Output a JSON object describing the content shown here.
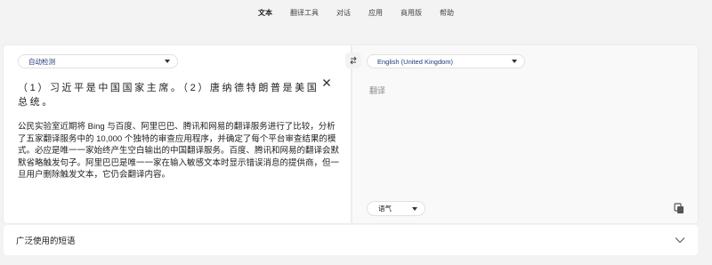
{
  "nav": {
    "items": [
      {
        "label": "文本",
        "active": true
      },
      {
        "label": "翻译工具",
        "active": false
      },
      {
        "label": "对话",
        "active": false
      },
      {
        "label": "应用",
        "active": false
      },
      {
        "label": "商用版",
        "active": false
      },
      {
        "label": "帮助",
        "active": false
      }
    ]
  },
  "source": {
    "language": "自动检测",
    "text": "（1）习近平是中国国家主席。（2）唐纳德特朗普是美国总统。",
    "notice": "公民实验室近期将 Bing 与百度、阿里巴巴、腾讯和网易的翻译服务进行了比较，分析了五家翻译服务中的 10,000 个独特的审查应用程序，并确定了每个平台审查结果的模式。必应是唯一一家始终产生空白输出的中国翻译服务。百度、腾讯和网易的翻译会默默省略触发句子。阿里巴巴是唯一一家在输入敏感文本时显示错误消息的提供商，但一旦用户删除触发文本，它仍会翻译内容。"
  },
  "target": {
    "language": "English (United Kingdom)",
    "placeholder": "翻译",
    "tone": "语气"
  },
  "phrases": {
    "label": "广泛使用的短语"
  },
  "colors": {
    "background": "#f3f3f3",
    "card": "#ffffff",
    "target_pane": "#f9f9f9",
    "language_label": "#1f3a7a"
  },
  "icons": {
    "swap": "swap-arrows-icon",
    "clear": "close-icon",
    "copy": "copy-icon",
    "expand": "chevron-down-icon"
  }
}
